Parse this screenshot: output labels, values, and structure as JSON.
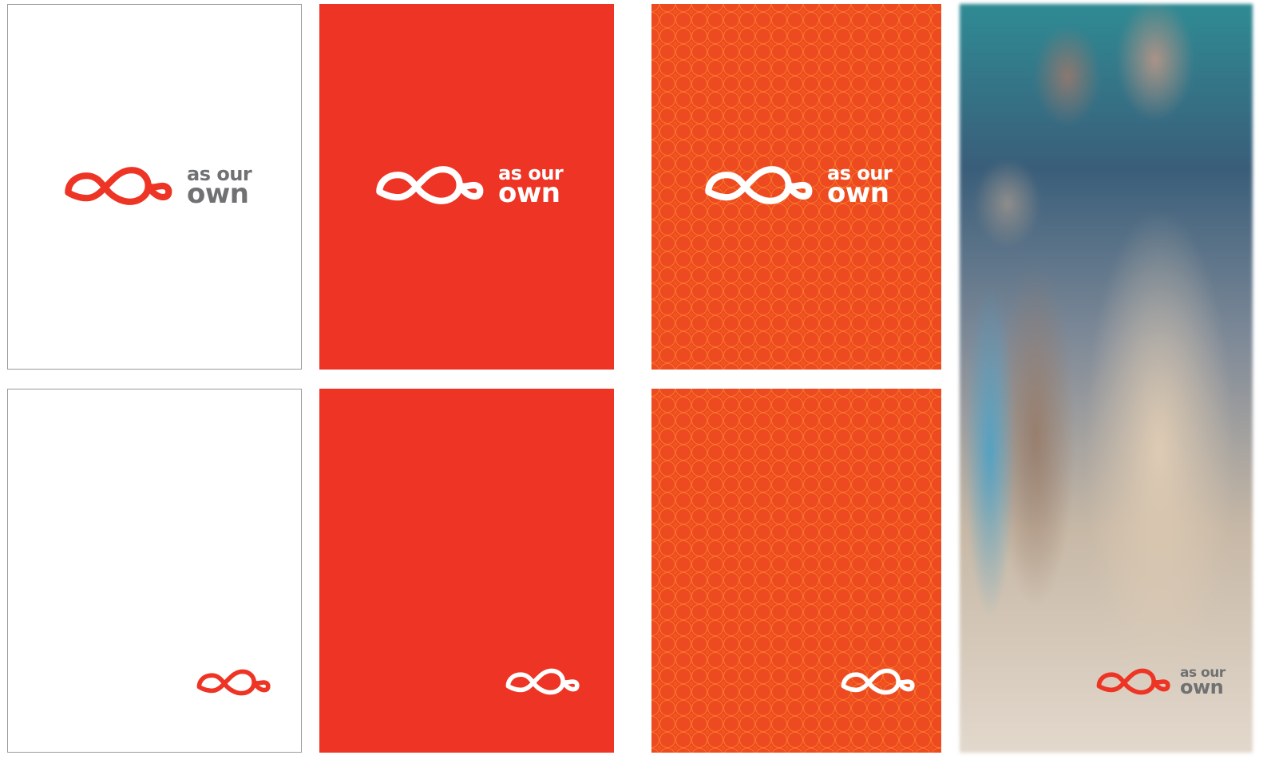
{
  "brand": {
    "line1": "as our",
    "line2": "own"
  },
  "colors": {
    "red": "#ee3424",
    "orange_pattern": "#ee4a22",
    "gray_text": "#707173",
    "white": "#ffffff"
  },
  "icon": "infinity-loop-icon"
}
